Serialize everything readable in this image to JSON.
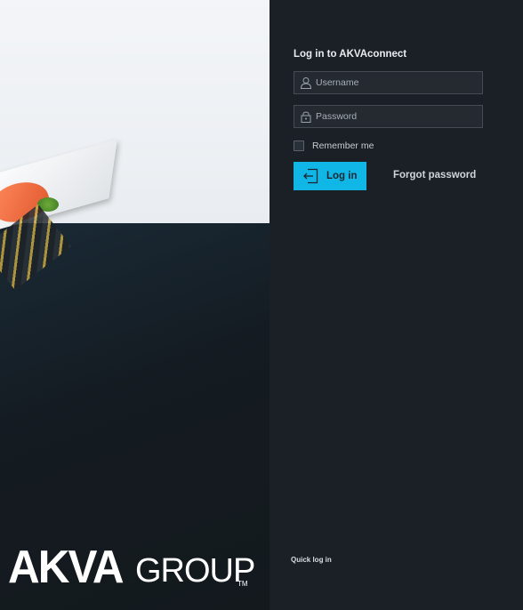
{
  "brand": {
    "logo_text_bold": "AKVA",
    "logo_text_light": "GROUP",
    "logo_tm": "TM"
  },
  "login": {
    "title": "Log in to AKVAconnect",
    "username": {
      "placeholder": "Username",
      "value": "",
      "icon": "user-icon"
    },
    "password": {
      "placeholder": "Password",
      "value": "",
      "icon": "lock-icon"
    },
    "remember_label": "Remember me",
    "remember_checked": false,
    "login_button_label": "Log in",
    "login_button_icon": "login-arrow-icon",
    "forgot_password_label": "Forgot password",
    "quick_login_label": "Quick log in"
  },
  "colors": {
    "accent": "#10b7e6",
    "panel_bg": "#1b1f26",
    "field_bg": "#252a31",
    "field_border": "#434b54"
  }
}
